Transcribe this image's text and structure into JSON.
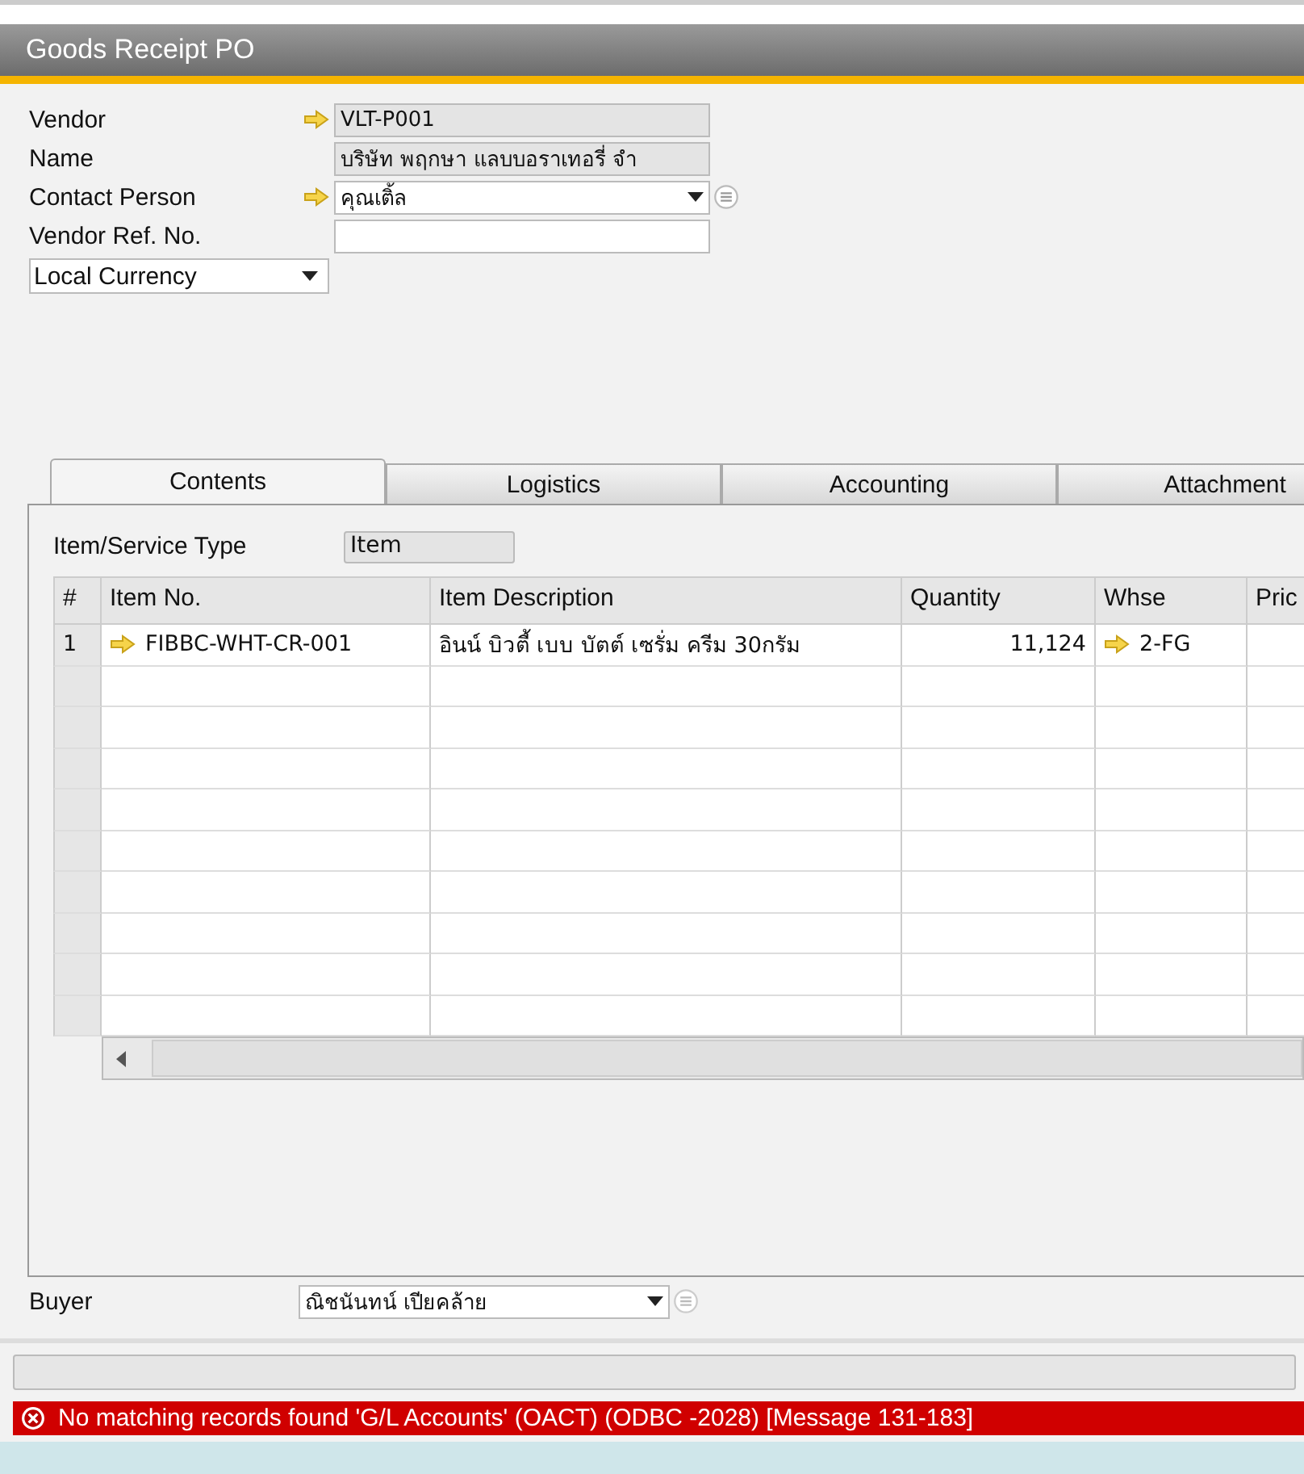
{
  "window": {
    "title": "Goods Receipt PO"
  },
  "header_fields": [
    {
      "label": "Vendor",
      "kind": "readonly",
      "link": true,
      "value": "VLT-P001"
    },
    {
      "label": "Name",
      "kind": "readonly",
      "link": false,
      "value": "บริษัท พฤกษา แลบบอราเทอรี่ จำ"
    },
    {
      "label": "Contact Person",
      "kind": "dropdown",
      "link": true,
      "value": "คุณเติ้ล"
    },
    {
      "label": "Vendor Ref. No.",
      "kind": "text",
      "link": false
    }
  ],
  "currency_dropdown": {
    "value": "Local Currency"
  },
  "tabs": [
    {
      "label": "Contents",
      "selected": true
    },
    {
      "label": "Logistics",
      "selected": false
    },
    {
      "label": "Accounting",
      "selected": false
    },
    {
      "label": "Attachment",
      "selected": false
    }
  ],
  "item_service_type": {
    "label": "Item/Service Type",
    "value": "Item"
  },
  "table": {
    "columns": [
      "#",
      "Item No.",
      "Item Description",
      "Quantity",
      "Whse",
      "Pric"
    ],
    "rows": [
      {
        "cells": [
          "1",
          "FIBBC-WHT-CR-001",
          "อินน์ บิวตี้ เบบ บัตต์ เซรั่ม ครีม 30กรัม",
          "11,124",
          "2-FG",
          ""
        ],
        "links": [
          false,
          true,
          false,
          false,
          true,
          false
        ]
      }
    ]
  },
  "buyer": {
    "label": "Buyer",
    "value": "ณิชนันทน์ เปียคล้าย"
  },
  "status_bar": {
    "message": "No matching records found  'G/L Accounts' (OACT) (ODBC -2028)  [Message 131-183]",
    "kind": "error"
  }
}
